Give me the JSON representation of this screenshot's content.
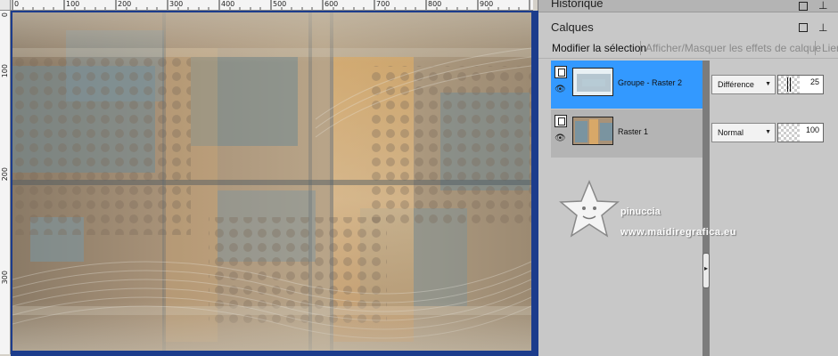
{
  "ruler": {
    "labels": [
      "0",
      "100",
      "200",
      "300",
      "400",
      "500",
      "600",
      "700",
      "800",
      "900"
    ],
    "vlabels": [
      "0",
      "100",
      "200",
      "300"
    ]
  },
  "panels": {
    "history_title": "Historique",
    "layers_title": "Calques",
    "toolbar": {
      "modify_selection": "Modifier la sélection",
      "toggle_effects": "Afficher/Masquer les effets de calque",
      "link": "Lier"
    }
  },
  "layers": [
    {
      "name": "Groupe - Raster 2",
      "blend_mode": "Différence",
      "opacity": "25",
      "selected": true
    },
    {
      "name": "Raster 1",
      "blend_mode": "Normal",
      "opacity": "100",
      "selected": false
    }
  ],
  "watermark": {
    "line1": "pinuccia",
    "line2": "www.maidiregrafica.eu"
  },
  "colors": {
    "selection": "#3399ff",
    "frame": "#1c3c8c",
    "panel_bg": "#c8c8c8"
  }
}
